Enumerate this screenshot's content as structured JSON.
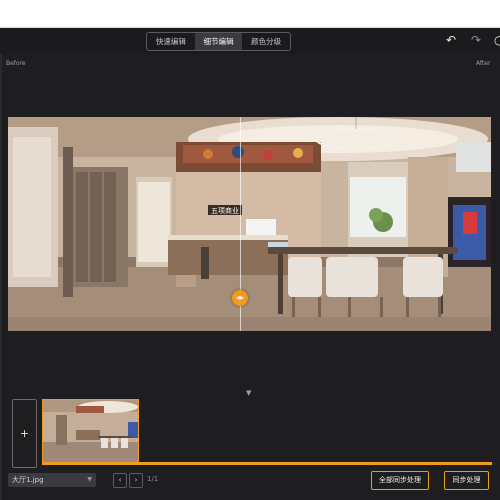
{
  "toolbar": {
    "tabs": [
      {
        "label": "快速编辑",
        "active": false
      },
      {
        "label": "细节编辑",
        "active": true
      },
      {
        "label": "颜色分级",
        "active": false
      }
    ],
    "undo_icon": "undo-icon",
    "redo_icon": "redo-icon"
  },
  "compare": {
    "before_label": "Before",
    "after_label": "After",
    "slider_fraction": 0.48
  },
  "scene": {
    "sign_text": "五项商业"
  },
  "filmstrip": {
    "add_label": "+"
  },
  "footer": {
    "file_name": "大厅1.jpg",
    "prev_label": "‹",
    "next_label": "›",
    "page_text": "1/1",
    "sync_all_label": "全部同步处理",
    "sync_label": "同步处理"
  },
  "colors": {
    "accent": "#f29a1b",
    "background": "#1e1e21"
  }
}
